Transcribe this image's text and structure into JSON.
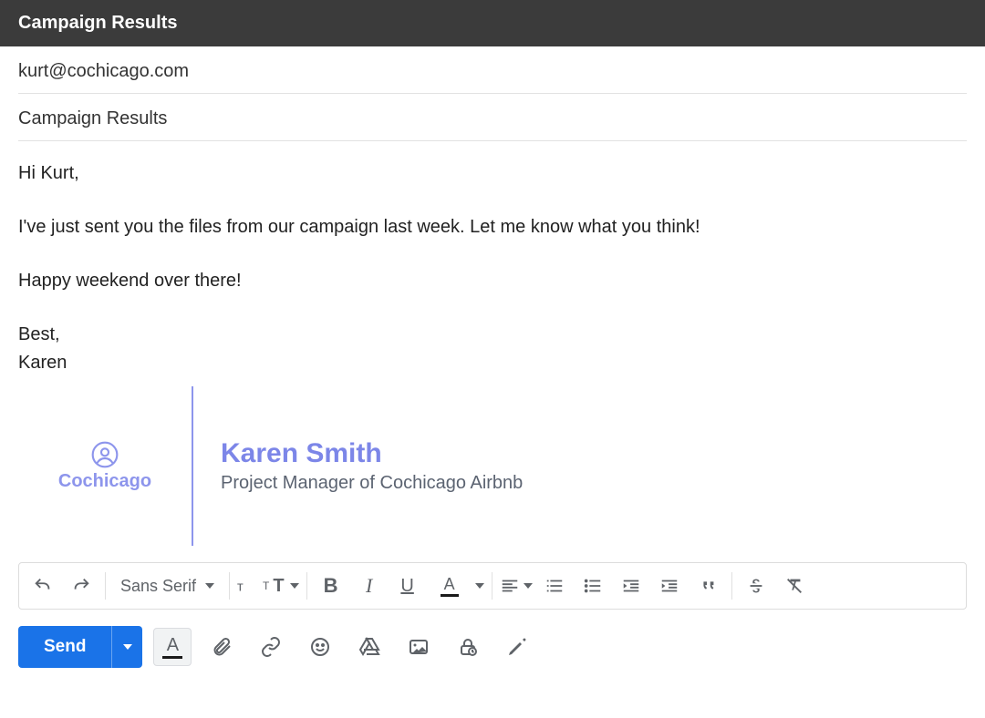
{
  "header": {
    "title": "Campaign Results"
  },
  "to": "kurt@cochicago.com",
  "subject": "Campaign Results",
  "body": {
    "greeting": "Hi Kurt,",
    "para1": "I've just sent you the files from our campaign last week. Let me know what you think!",
    "para2": "Happy weekend over there!",
    "signoff": "Best,",
    "sender_first": "Karen"
  },
  "signature": {
    "brand": "Cochicago",
    "name": "Karen Smith",
    "title": "Project Manager of Cochicago Airbnb"
  },
  "toolbar": {
    "font": "Sans Serif"
  },
  "actions": {
    "send_label": "Send"
  }
}
